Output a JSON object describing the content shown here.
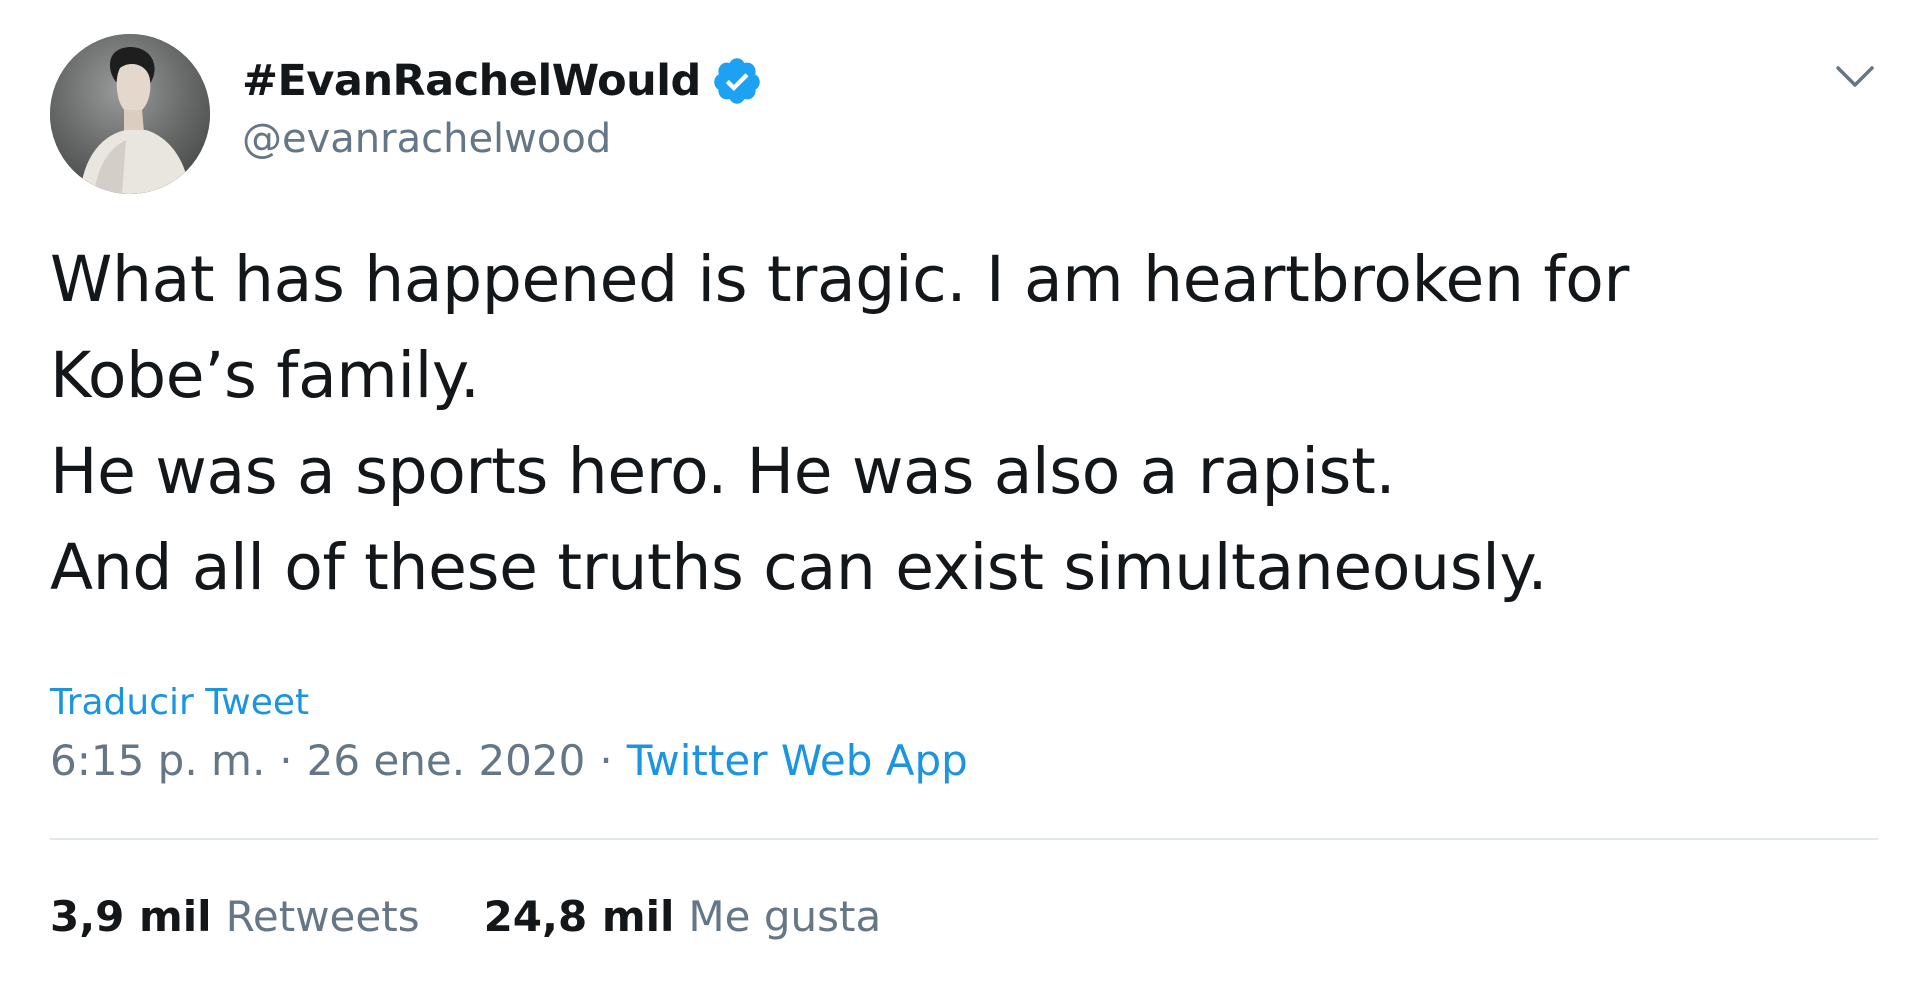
{
  "author": {
    "display_name": "#EvanRachelWould",
    "handle": "@evanrachelwood",
    "verified_icon": "verified-badge-icon",
    "avatar": "profile-photo"
  },
  "tweet": {
    "lines": [
      "What has happened is tragic. I am heartbroken for",
      "Kobe’s family.",
      "He was a sports hero. He was also a rapist.",
      "And all of these truths can exist simultaneously."
    ],
    "translate_label": "Traducir Tweet",
    "time": "6:15 p. m.",
    "separator": "·",
    "date": "26 ene. 2020",
    "source": "Twitter Web App"
  },
  "stats": {
    "retweets_count": "3,9 mil",
    "retweets_label": "Retweets",
    "likes_count": "24,8 mil",
    "likes_label": "Me gusta"
  },
  "colors": {
    "link": "#1b95e0",
    "verified": "#1da1f2",
    "secondary_text": "#657786",
    "primary_text": "#14171a",
    "divider": "#e1e8ed"
  }
}
